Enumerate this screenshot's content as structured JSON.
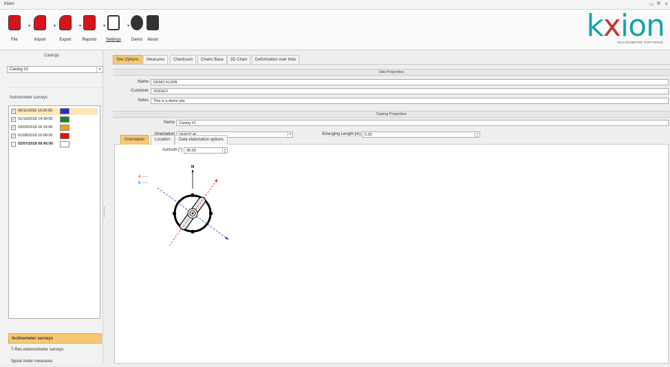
{
  "window": {
    "title": "Kliion"
  },
  "ribbon": {
    "buttons": [
      {
        "label": "File"
      },
      {
        "label": "Import"
      },
      {
        "label": "Export"
      },
      {
        "label": "Reports"
      },
      {
        "label": "Settings"
      },
      {
        "label": "Demo"
      },
      {
        "label": "About"
      }
    ],
    "logo": {
      "text_a": "k",
      "text_b": "x",
      "text_c": "ion",
      "subtitle": "INCLINOMETER SOFTWARE"
    }
  },
  "left": {
    "casings_title": "Casings",
    "casing_selected": "Casing #1",
    "surveys_title": "Inclinometer surveys",
    "surveys": [
      {
        "date": "05/11/2018 10:20:00",
        "checked": true,
        "color": "#1f2ed6",
        "highlight": true
      },
      {
        "date": "01/10/2018 14:30:00",
        "checked": true,
        "color": "#0a8a22"
      },
      {
        "date": "03/09/2018 16:15:00",
        "checked": true,
        "color": "#f2a100"
      },
      {
        "date": "01/08/2018 10:00:00",
        "checked": true,
        "color": "#e01010"
      },
      {
        "date": "02/07/2018 09:45:00",
        "checked": false,
        "color": "#ffffff",
        "bold": true
      }
    ],
    "nav": [
      {
        "label": "Inclinometer surveys",
        "active": true
      },
      {
        "label": "T-Rex extensometer surveys"
      },
      {
        "label": "Spiral meter measures"
      }
    ]
  },
  "tabs": [
    {
      "label": "Site Options",
      "active": true
    },
    {
      "label": "Measures"
    },
    {
      "label": "Checksum"
    },
    {
      "label": "Charts Base"
    },
    {
      "label": "3D Chart"
    },
    {
      "label": "Deformation over time"
    }
  ],
  "site": {
    "title": "Site Properties",
    "name_label": "Name",
    "name_value": "DEMO KLION",
    "customer_label": "Customer",
    "customer_value": "SISGEO",
    "notes_label": "Notes",
    "notes_value": "This is a demo site"
  },
  "casing": {
    "title": "Casing Properties",
    "name_label": "Name",
    "name_value": "Casing #1",
    "orientation_label": "Orientation",
    "orientation_value": "VERTICAL",
    "emerging_label": "Emerging Lenght [m]",
    "emerging_value": "0.30"
  },
  "inner_tabs": [
    {
      "label": "Orientation",
      "active": true
    },
    {
      "label": "Location"
    },
    {
      "label": "Data elaboration options"
    }
  ],
  "orientation": {
    "azimuth_label": "Azimuth [°]",
    "azimuth_value": "36.00",
    "legend_a": "A -----",
    "legend_b": "B -----",
    "north": "N",
    "azimuth_deg": 36
  },
  "colors": {
    "accent": "#f7c873",
    "logo": "#18a3ad",
    "axis_a": "#e02020",
    "axis_b": "#1f3fd0"
  }
}
